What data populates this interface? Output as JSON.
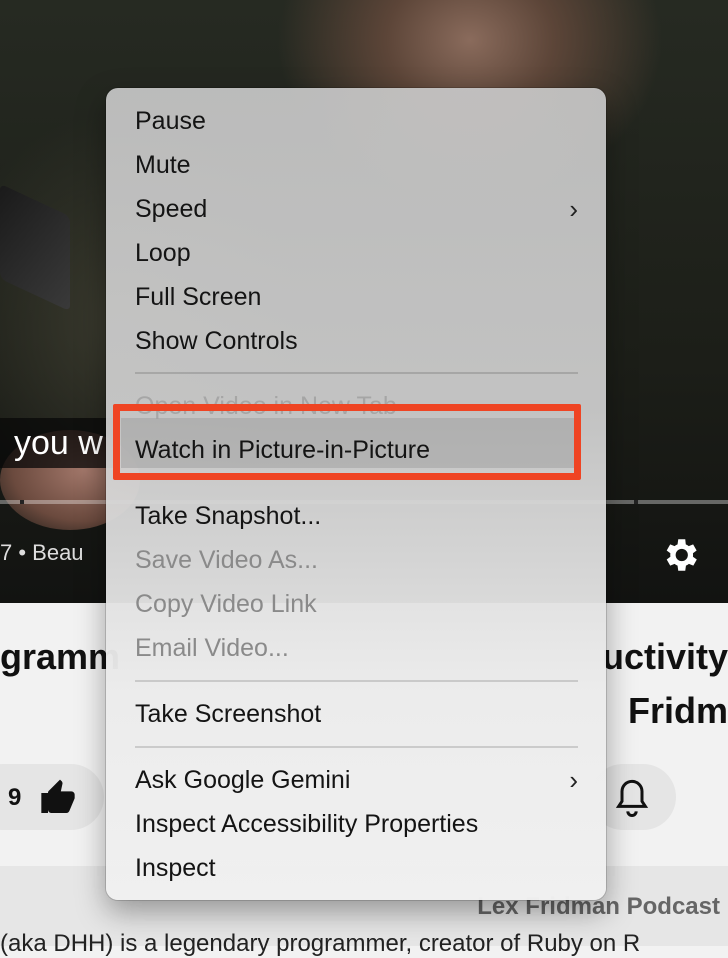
{
  "video": {
    "caption": "you w",
    "meta_text": "7  •  Beau"
  },
  "page": {
    "title_left": "gramm",
    "title_right_line1": "uctivity",
    "title_right_line2": "Fridm",
    "like_count": "9",
    "channel": "Lex Fridman Podcast",
    "description": "(aka DHH) is a legendary programmer, creator of Ruby on R"
  },
  "menu": {
    "pause": "Pause",
    "mute": "Mute",
    "speed": "Speed",
    "loop": "Loop",
    "full_screen": "Full Screen",
    "show_controls": "Show Controls",
    "open_new_tab": "Open Video in New Tab",
    "pip": "Watch in Picture-in-Picture",
    "take_snapshot": "Take Snapshot...",
    "save_video": "Save Video As...",
    "copy_link": "Copy Video Link",
    "email_video": "Email Video...",
    "take_screenshot": "Take Screenshot",
    "ask_gemini": "Ask Google Gemini",
    "inspect_accessibility": "Inspect Accessibility Properties",
    "inspect": "Inspect",
    "submenu_chevron": "›"
  },
  "colors": {
    "highlight_box": "#ef4423"
  }
}
